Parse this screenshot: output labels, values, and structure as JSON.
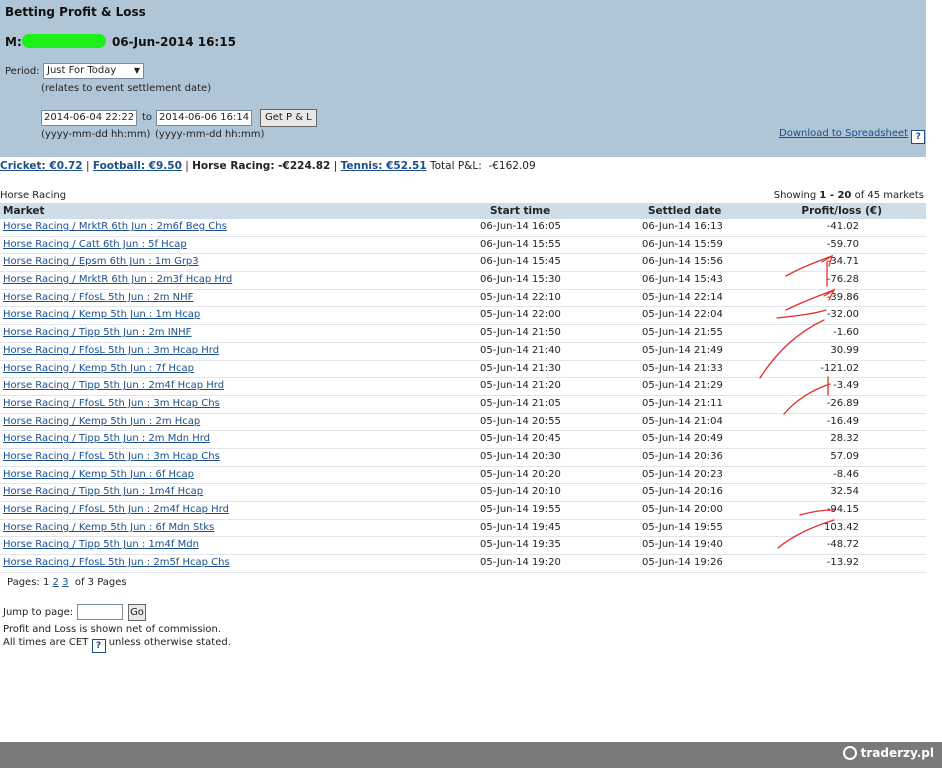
{
  "header": {
    "title": "Betting Profit & Loss",
    "account_prefix": "M:",
    "account_datetime": "06-Jun-2014 16:15",
    "period_label": "Period:",
    "period_value": "Just For Today",
    "period_note": "(relates to event settlement date)",
    "from_date": "2014-06-04 22:22",
    "to_label": "to",
    "to_date": "2014-06-06 16:14",
    "get_button": "Get P & L",
    "format_hint_from": "(yyyy-mm-dd hh:mm)",
    "format_hint_to": "(yyyy-mm-dd hh:mm)",
    "download_link": "Download to Spreadsheet",
    "help_glyph": "?"
  },
  "summary": {
    "cricket": "Cricket: €0.72",
    "football": "Football: €9.50",
    "horse_racing": "Horse Racing: -€224.82",
    "tennis": "Tennis: €52.51",
    "total_label": "Total P&L:",
    "total_value": "-€162.09"
  },
  "section": {
    "title": "Horse Racing",
    "showing_prefix": "Showing",
    "showing_range": "1 - 20",
    "showing_suffix": "of 45 markets"
  },
  "table": {
    "columns": [
      "Market",
      "Start time",
      "Settled date",
      "Profit/loss (€)"
    ],
    "rows": [
      {
        "market": "Horse Racing / MrktR 6th Jun : 2m6f Beg Chs",
        "start": "06-Jun-14 16:05",
        "settled": "06-Jun-14 16:13",
        "pl": "-41.02"
      },
      {
        "market": "Horse Racing / Catt 6th Jun : 5f Hcap",
        "start": "06-Jun-14 15:55",
        "settled": "06-Jun-14 15:59",
        "pl": "-59.70"
      },
      {
        "market": "Horse Racing / Epsm 6th Jun : 1m Grp3",
        "start": "06-Jun-14 15:45",
        "settled": "06-Jun-14 15:56",
        "pl": "-34.71"
      },
      {
        "market": "Horse Racing / MrktR 6th Jun : 2m3f Hcap Hrd",
        "start": "06-Jun-14 15:30",
        "settled": "06-Jun-14 15:43",
        "pl": "-76.28"
      },
      {
        "market": "Horse Racing / FfosL 5th Jun : 2m NHF",
        "start": "05-Jun-14 22:10",
        "settled": "05-Jun-14 22:14",
        "pl": "-39.86"
      },
      {
        "market": "Horse Racing / Kemp 5th Jun : 1m Hcap",
        "start": "05-Jun-14 22:00",
        "settled": "05-Jun-14 22:04",
        "pl": "-32.00"
      },
      {
        "market": "Horse Racing / Tipp 5th Jun : 2m INHF",
        "start": "05-Jun-14 21:50",
        "settled": "05-Jun-14 21:55",
        "pl": "-1.60"
      },
      {
        "market": "Horse Racing / FfosL 5th Jun : 3m Hcap Hrd",
        "start": "05-Jun-14 21:40",
        "settled": "05-Jun-14 21:49",
        "pl": "30.99"
      },
      {
        "market": "Horse Racing / Kemp 5th Jun : 7f Hcap",
        "start": "05-Jun-14 21:30",
        "settled": "05-Jun-14 21:33",
        "pl": "-121.02"
      },
      {
        "market": "Horse Racing / Tipp 5th Jun : 2m4f Hcap Hrd",
        "start": "05-Jun-14 21:20",
        "settled": "05-Jun-14 21:29",
        "pl": "-3.49"
      },
      {
        "market": "Horse Racing / FfosL 5th Jun : 3m Hcap Chs",
        "start": "05-Jun-14 21:05",
        "settled": "05-Jun-14 21:11",
        "pl": "-26.89"
      },
      {
        "market": "Horse Racing / Kemp 5th Jun : 2m Hcap",
        "start": "05-Jun-14 20:55",
        "settled": "05-Jun-14 21:04",
        "pl": "-16.49"
      },
      {
        "market": "Horse Racing / Tipp 5th Jun : 2m Mdn Hrd",
        "start": "05-Jun-14 20:45",
        "settled": "05-Jun-14 20:49",
        "pl": "28.32"
      },
      {
        "market": "Horse Racing / FfosL 5th Jun : 3m Hcap Chs",
        "start": "05-Jun-14 20:30",
        "settled": "05-Jun-14 20:36",
        "pl": "57.09"
      },
      {
        "market": "Horse Racing / Kemp 5th Jun : 6f Hcap",
        "start": "05-Jun-14 20:20",
        "settled": "05-Jun-14 20:23",
        "pl": "-8.46"
      },
      {
        "market": "Horse Racing / Tipp 5th Jun : 1m4f Hcap",
        "start": "05-Jun-14 20:10",
        "settled": "05-Jun-14 20:16",
        "pl": "32.54"
      },
      {
        "market": "Horse Racing / FfosL 5th Jun : 2m4f Hcap Hrd",
        "start": "05-Jun-14 19:55",
        "settled": "05-Jun-14 20:00",
        "pl": "-94.15"
      },
      {
        "market": "Horse Racing / Kemp 5th Jun : 6f Mdn Stks",
        "start": "05-Jun-14 19:45",
        "settled": "05-Jun-14 19:55",
        "pl": "103.42"
      },
      {
        "market": "Horse Racing / Tipp 5th Jun : 1m4f Mdn",
        "start": "05-Jun-14 19:35",
        "settled": "05-Jun-14 19:40",
        "pl": "-48.72"
      },
      {
        "market": "Horse Racing / FfosL 5th Jun : 2m5f Hcap Chs",
        "start": "05-Jun-14 19:20",
        "settled": "05-Jun-14 19:26",
        "pl": "-13.92"
      }
    ]
  },
  "pagination": {
    "label": "Pages:",
    "current": "1",
    "page2": "2",
    "page3": "3",
    "suffix": "of 3 Pages"
  },
  "jump": {
    "label": "Jump to page:",
    "value": "",
    "go": "Go"
  },
  "notes": {
    "commission": "Profit and Loss is shown net of commission.",
    "times_prefix": "All times are CET",
    "times_suffix": "unless otherwise stated."
  },
  "footer": {
    "brand": "traderzy.pl"
  },
  "colors": {
    "header_bg": "#b0c5d6",
    "table_header_bg": "#cfdde8",
    "link": "#1a4f8b",
    "redaction": "#1df01a",
    "annotation": "#e0302a",
    "footer_bg": "#7a7a7a"
  }
}
